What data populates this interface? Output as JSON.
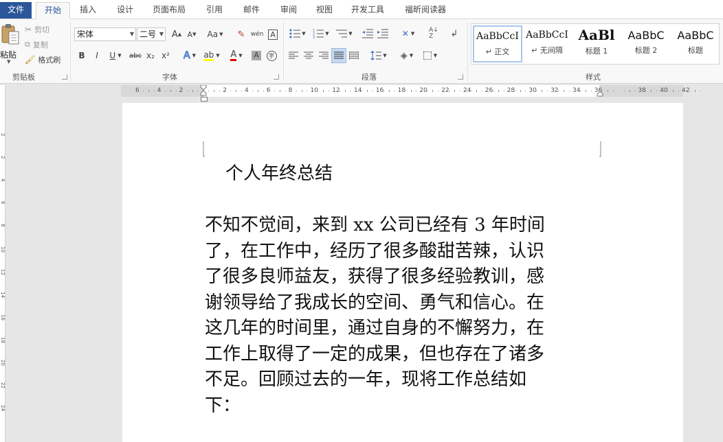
{
  "tabs": [
    {
      "label": "文件",
      "kind": "file"
    },
    {
      "label": "开始",
      "kind": "active"
    },
    {
      "label": "插入",
      "kind": ""
    },
    {
      "label": "设计",
      "kind": ""
    },
    {
      "label": "页面布局",
      "kind": ""
    },
    {
      "label": "引用",
      "kind": ""
    },
    {
      "label": "邮件",
      "kind": ""
    },
    {
      "label": "审阅",
      "kind": ""
    },
    {
      "label": "视图",
      "kind": ""
    },
    {
      "label": "开发工具",
      "kind": ""
    },
    {
      "label": "福昕阅读器",
      "kind": ""
    }
  ],
  "clipboard": {
    "paste": "粘贴",
    "cut": "剪切",
    "copy": "复制",
    "format_painter": "格式刷",
    "group_label": "剪贴板"
  },
  "font": {
    "name": "宋体",
    "size": "二号",
    "group_label": "字体",
    "grow": "A",
    "shrink": "A",
    "case": "Aa",
    "bold": "B",
    "italic": "I",
    "underline": "U",
    "strike": "abc",
    "subscript": "x₂",
    "superscript": "x²",
    "phonetic": "wén",
    "border_char": "A",
    "text_effect": "A",
    "font_color": "A",
    "shading": "A",
    "enclose": "字"
  },
  "paragraph": {
    "group_label": "段落"
  },
  "styles": {
    "group_label": "样式",
    "items": [
      {
        "sample": "AaBbCcI",
        "name": "↵ 正文"
      },
      {
        "sample": "AaBbCcI",
        "name": "↵ 无间隔"
      },
      {
        "sample": "AaBl",
        "name": "标题 1"
      },
      {
        "sample": "AaBbC",
        "name": "标题 2"
      },
      {
        "sample": "AaBbC",
        "name": "标题"
      }
    ]
  },
  "ruler": {
    "labels": [
      "6",
      "4",
      "2",
      "",
      "2",
      "4",
      "6",
      "8",
      "10",
      "12",
      "14",
      "16",
      "18",
      "20",
      "22",
      "24",
      "26",
      "28",
      "30",
      "32",
      "34",
      "36",
      "",
      "38",
      "40",
      "42"
    ]
  },
  "vruler": {
    "labels": [
      "2",
      "2",
      "4",
      "6",
      "8",
      "10",
      "12",
      "14",
      "16",
      "18",
      "20",
      "22",
      "24"
    ]
  },
  "colors": {
    "file_tab": "#2b579a",
    "highlight": "#ffff00",
    "font_color": "#e00000"
  },
  "document": {
    "title": "个人年终总结",
    "paragraph_lines": [
      "不知不觉间，来到 xx 公司已经有 3 年时间",
      "了，在工作中，经历了很多酸甜苦辣，认识",
      "了很多良师益友，获得了很多经验教训，感",
      "谢领导给了我成长的空间、勇气和信心。在",
      "这几年的时间里，通过自身的不懈努力，在",
      "工作上取得了一定的成果，但也存在了诸多",
      "不足。回顾过去的一年，现将工作总结如",
      "下："
    ]
  }
}
